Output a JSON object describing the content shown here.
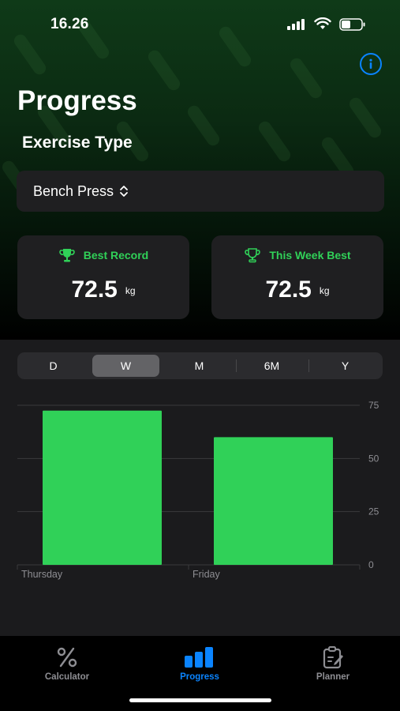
{
  "status_bar": {
    "time": "16.26"
  },
  "header": {
    "title": "Progress",
    "section_label": "Exercise Type",
    "info_icon": "info-circle-icon"
  },
  "picker": {
    "selected": "Bench Press",
    "icon": "chevron-up-down-icon"
  },
  "cards": [
    {
      "label": "Best Record",
      "value": "72.5",
      "unit": "kg",
      "icon": "trophy-icon"
    },
    {
      "label": "This Week Best",
      "value": "72.5",
      "unit": "kg",
      "icon": "trophy-icon"
    }
  ],
  "segments": {
    "items": [
      "D",
      "W",
      "M",
      "6M",
      "Y"
    ],
    "selected": "W"
  },
  "chart_data": {
    "type": "bar",
    "categories": [
      "Thursday",
      "Friday"
    ],
    "values": [
      72.5,
      60
    ],
    "ylim": [
      0,
      75
    ],
    "yticks": [
      0,
      25,
      50,
      75
    ],
    "grid": true,
    "color": "#30d158"
  },
  "tabbar": {
    "items": [
      {
        "label": "Calculator",
        "icon": "percent-icon",
        "active": false
      },
      {
        "label": "Progress",
        "icon": "bar-chart-icon",
        "active": true
      },
      {
        "label": "Planner",
        "icon": "clipboard-edit-icon",
        "active": false
      }
    ]
  },
  "colors": {
    "accent_green": "#30d158",
    "accent_blue": "#0a84ff",
    "card_bg": "#1f1f21"
  }
}
